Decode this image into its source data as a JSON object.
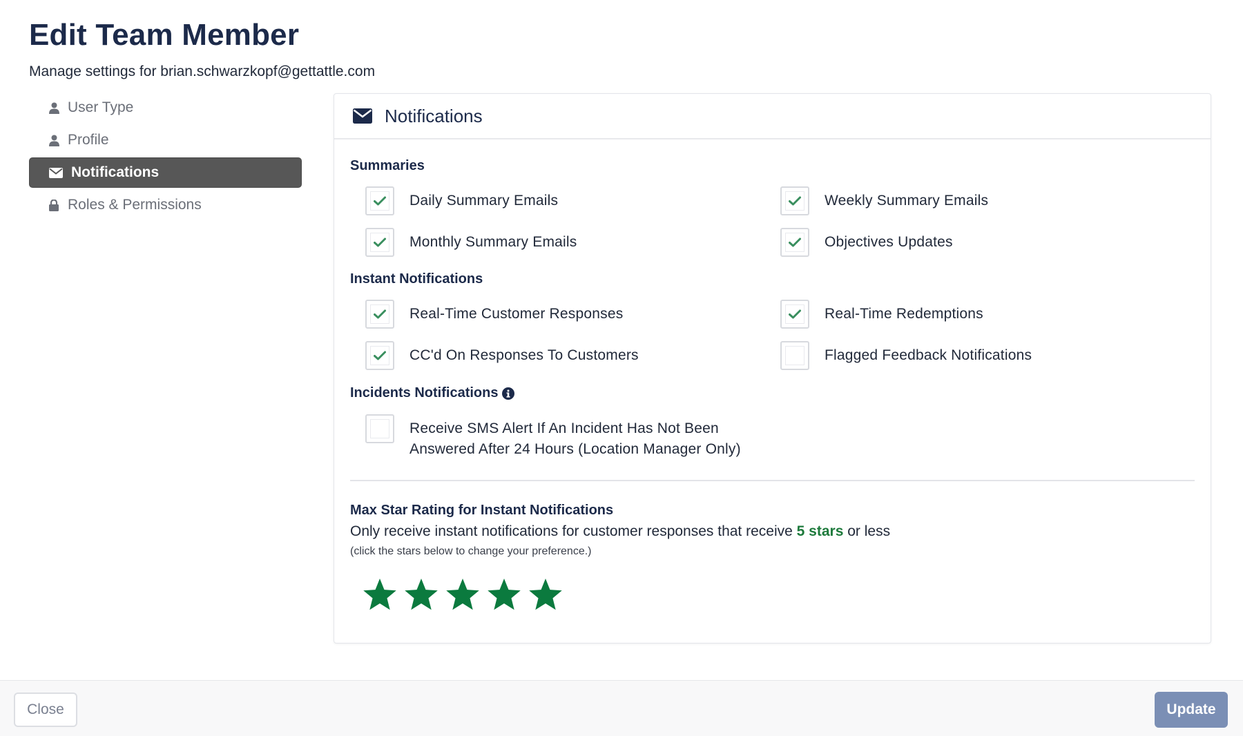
{
  "page": {
    "title": "Edit Team Member",
    "subtitle_prefix": "Manage settings for",
    "email": "brian.schwarzkopf@gettattle.com"
  },
  "sidebar": {
    "items": [
      {
        "label": "User Type",
        "icon": "user-icon",
        "active": false
      },
      {
        "label": "Profile",
        "icon": "user-icon",
        "active": false
      },
      {
        "label": "Notifications",
        "icon": "envelope-icon",
        "active": true
      },
      {
        "label": "Roles & Permissions",
        "icon": "lock-icon",
        "active": false
      }
    ]
  },
  "panel": {
    "title": "Notifications",
    "icon": "envelope-icon",
    "summaries": {
      "heading": "Summaries",
      "options": [
        {
          "label": "Daily Summary Emails",
          "checked": true
        },
        {
          "label": "Weekly Summary Emails",
          "checked": true
        },
        {
          "label": "Monthly Summary Emails",
          "checked": true
        },
        {
          "label": "Objectives Updates",
          "checked": true
        }
      ]
    },
    "instant": {
      "heading": "Instant Notifications",
      "options": [
        {
          "label": "Real-Time Customer Responses",
          "checked": true
        },
        {
          "label": "Real-Time Redemptions",
          "checked": true
        },
        {
          "label": "CC'd On Responses To Customers",
          "checked": true
        },
        {
          "label": "Flagged Feedback Notifications",
          "checked": false
        }
      ]
    },
    "incidents": {
      "heading": "Incidents Notifications",
      "info_icon": "info-circle-icon",
      "options": [
        {
          "label_line1": "Receive SMS Alert If An Incident Has Not Been",
          "label_line2": "Answered After 24 Hours (Location Manager Only)",
          "checked": false
        }
      ]
    },
    "rating": {
      "title": "Max Star Rating for Instant Notifications",
      "desc_prefix": "Only receive instant notifications for customer responses that receive",
      "desc_value": "5 stars",
      "desc_suffix": "or less",
      "hint": "(click the stars below to change your preference.)",
      "selected_stars": 5,
      "max_stars": 5,
      "star_color": "#0b7a3e"
    }
  },
  "footer": {
    "close_label": "Close",
    "update_label": "Update"
  },
  "colors": {
    "check": "#3a8f5f",
    "active_sidebar_bg": "#575757",
    "update_button_bg": "#7b8fb5",
    "star_highlight": "#1e7a3c"
  }
}
